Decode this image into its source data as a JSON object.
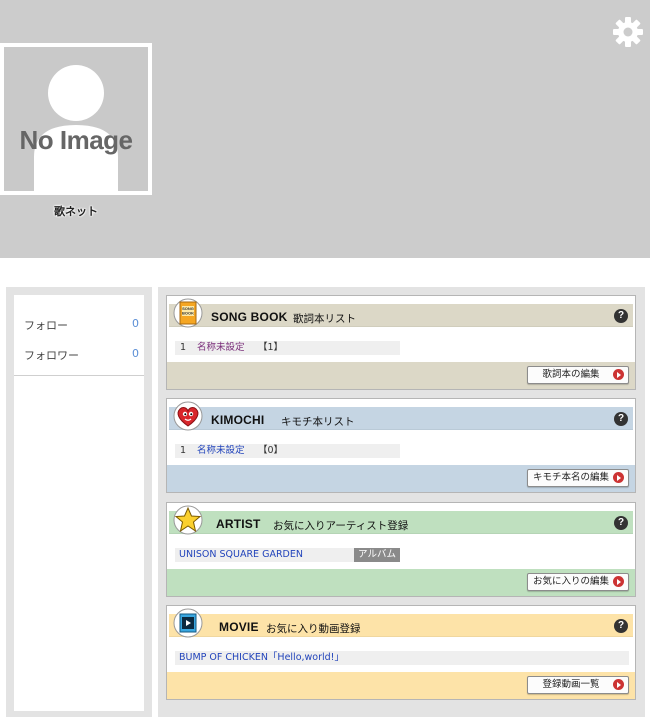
{
  "profile": {
    "avatar_text": "No Image",
    "username": "歌ネット"
  },
  "stats": [
    {
      "label": "フォロー",
      "count": "0"
    },
    {
      "label": "フォロワー",
      "count": "0"
    }
  ],
  "panels": {
    "songbook": {
      "title": "SONG BOOK",
      "subtitle": "歌詞本リスト",
      "icon_text": "SONG BOOK",
      "item_number": "1",
      "item_name": "名称未設定",
      "item_count": "【1】",
      "button": "歌詞本の編集",
      "head_color": "#dcd8c7",
      "foot_color": "#dcd8c7",
      "link_color": "#7a2d7a"
    },
    "kimochi": {
      "title": "KIMOCHI",
      "subtitle": "キモチ本リスト",
      "item_number": "1",
      "item_name": "名称未設定",
      "item_count": "【0】",
      "button": "キモチ本名の編集",
      "head_color": "#c5d5e3",
      "foot_color": "#c5d5e3",
      "link_color": "#2244bb"
    },
    "artist": {
      "title": "ARTIST",
      "subtitle": "お気に入りアーティスト登録",
      "item_name": "UNISON SQUARE GARDEN",
      "album": "アルバム",
      "button": "お気に入りの編集",
      "head_color": "#bfe0bf",
      "foot_color": "#bfe0bf",
      "link_color": "#2244bb"
    },
    "movie": {
      "title": "MOVIE",
      "subtitle": "お気に入り動画登録",
      "item_name": "BUMP OF CHICKEN「Hello,world!」",
      "button": "登録動画一覧",
      "head_color": "#fde3a8",
      "foot_color": "#fde3a8",
      "link_color": "#2244bb"
    }
  },
  "icons": {
    "settings": "gear-icon",
    "help": "help-icon"
  },
  "help_glyph": "?"
}
